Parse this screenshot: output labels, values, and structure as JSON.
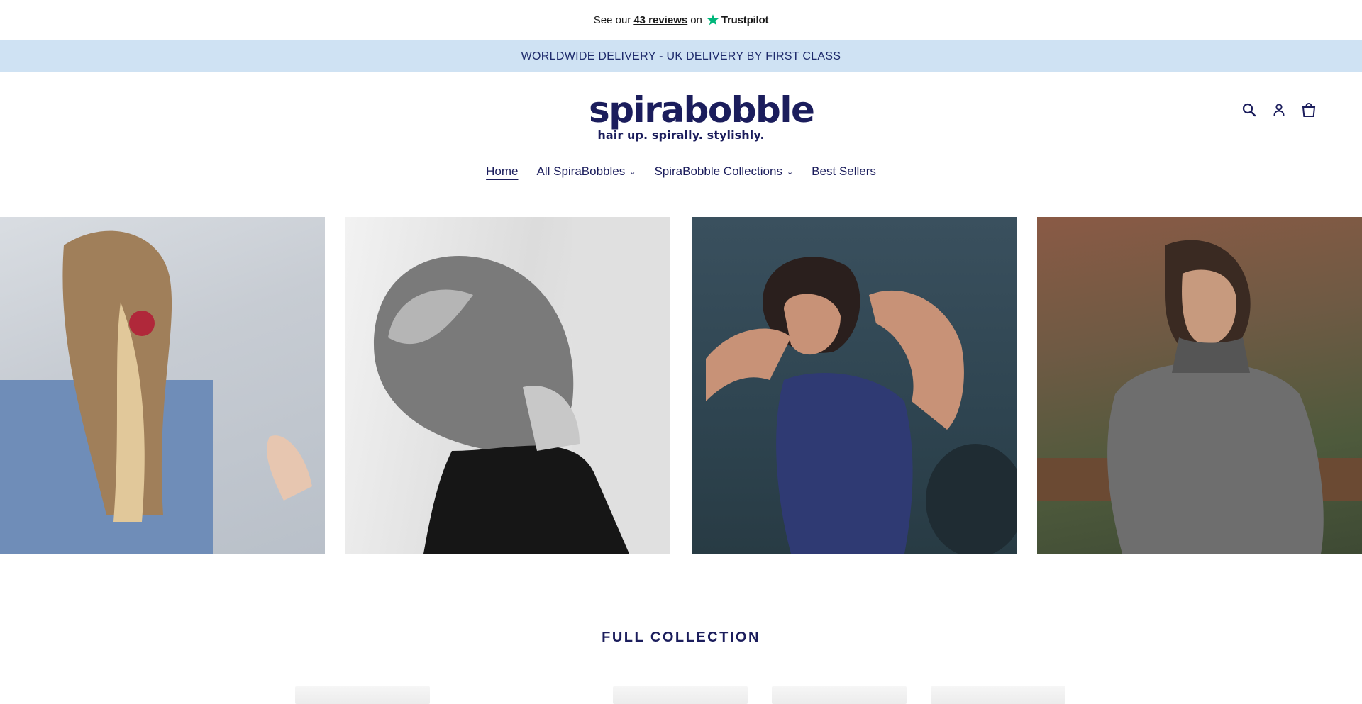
{
  "trustpilot": {
    "prefix": "See our",
    "reviews_link": "43 reviews",
    "suffix": "on",
    "brand": "Trustpilot",
    "star_color": "#00b67a"
  },
  "announcement": {
    "text": "WORLDWIDE DELIVERY - UK DELIVERY BY FIRST CLASS",
    "background": "#cfe2f3"
  },
  "header": {
    "logo_text": "spirabobble",
    "logo_tagline": "hair up. spirally. stylishly.",
    "brand_color": "#1b1d5c",
    "icons": [
      "search-icon",
      "account-icon",
      "cart-icon"
    ]
  },
  "nav": {
    "items": [
      {
        "label": "Home",
        "active": true,
        "dropdown": false
      },
      {
        "label": "All SpiraBobbles",
        "active": false,
        "dropdown": true
      },
      {
        "label": "SpiraBobble Collections",
        "active": false,
        "dropdown": true
      },
      {
        "label": "Best Sellers",
        "active": false,
        "dropdown": false
      }
    ]
  },
  "gallery": {
    "photos": [
      "ponytail-blonde-red-spirabobble",
      "ponytail-black-and-white",
      "woman-tying-hair-gym",
      "woman-knit-sweater-outdoors"
    ]
  },
  "collection": {
    "title": "FULL COLLECTION"
  }
}
